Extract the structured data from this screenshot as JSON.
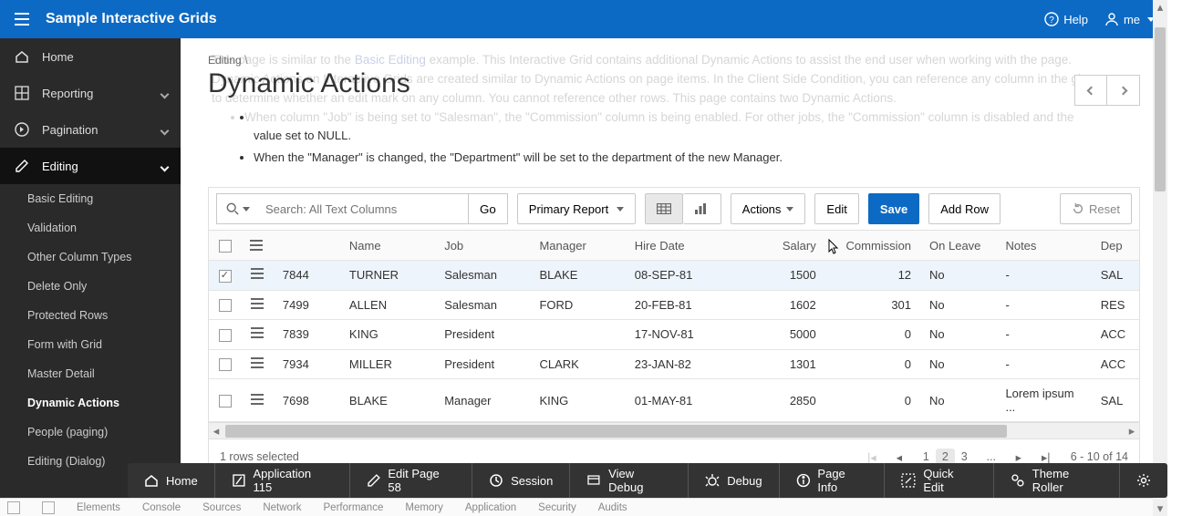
{
  "top": {
    "app_title": "Sample Interactive Grids",
    "help": "Help",
    "user": "me"
  },
  "sidebar": {
    "items": [
      {
        "icon": "home",
        "label": "Home",
        "kind": "top"
      },
      {
        "icon": "grid",
        "label": "Reporting",
        "kind": "top",
        "expandable": true
      },
      {
        "icon": "circle-right",
        "label": "Pagination",
        "kind": "top",
        "expandable": true
      },
      {
        "icon": "edit",
        "label": "Editing",
        "kind": "top",
        "expandable": true,
        "open": true
      }
    ],
    "sub": [
      "Basic Editing",
      "Validation",
      "Other Column Types",
      "Delete Only",
      "Protected Rows",
      "Form with Grid",
      "Master Detail",
      "Dynamic Actions",
      "People (paging)",
      "Editing (Dialog)"
    ],
    "active_sub": "Dynamic Actions"
  },
  "breadcrumb": {
    "parent": "Editing",
    "title": "Dynamic Actions"
  },
  "ghost": {
    "p1a": "This page is similar to the ",
    "link": "Basic Editing",
    "p1b": " example. This Interactive Grid contains additional Dynamic Actions to assist the end user when working with the page.",
    "p2": "Dynamic Actions on Interactive Grids are created similar to Dynamic Actions on page items. In the Client Side Condition, you can reference any column in the given row to determine whether an edit mark on any column. You cannot reference other rows. This page contains two Dynamic Actions.",
    "li1": "When column \"Job\" is being set to \"Salesman\", the \"Commission\" column is being enabled. For other jobs, the \"Commission\" column is disabled and the "
  },
  "desc": {
    "li1_tail": "value set to NULL.",
    "li2": "When the \"Manager\" is changed, the \"Department\" will be set to the department of the new Manager."
  },
  "toolbar": {
    "search_placeholder": "Search: All Text Columns",
    "go": "Go",
    "report_sel": "Primary Report",
    "actions": "Actions",
    "edit": "Edit",
    "save": "Save",
    "add_row": "Add Row",
    "reset": "Reset"
  },
  "grid": {
    "headers": [
      "",
      "",
      "",
      "Name",
      "Job",
      "Manager",
      "Hire Date",
      "Salary",
      "Commission",
      "On Leave",
      "Notes",
      "Dep"
    ],
    "rows": [
      {
        "selected": true,
        "id": "7844",
        "name": "TURNER",
        "job": "Salesman",
        "manager": "BLAKE",
        "hire": "08-SEP-81",
        "salary": "1500",
        "commission": "12",
        "onleave": "No",
        "notes": "-",
        "dep": "SAL"
      },
      {
        "selected": false,
        "id": "7499",
        "name": "ALLEN",
        "job": "Salesman",
        "manager": "FORD",
        "hire": "20-FEB-81",
        "salary": "1602",
        "commission": "301",
        "onleave": "No",
        "notes": "-",
        "dep": "RES"
      },
      {
        "selected": false,
        "id": "7839",
        "name": "KING",
        "job": "President",
        "manager": "",
        "hire": "17-NOV-81",
        "salary": "5000",
        "commission": "0",
        "onleave": "No",
        "notes": "-",
        "dep": "ACC"
      },
      {
        "selected": false,
        "id": "7934",
        "name": "MILLER",
        "job": "President",
        "manager": "CLARK",
        "hire": "23-JAN-82",
        "salary": "1301",
        "commission": "0",
        "onleave": "No",
        "notes": "-",
        "dep": "ACC"
      },
      {
        "selected": false,
        "id": "7698",
        "name": "BLAKE",
        "job": "Manager",
        "manager": "KING",
        "hire": "01-MAY-81",
        "salary": "2850",
        "commission": "0",
        "onleave": "No",
        "notes": "Lorem ipsum ...",
        "dep": "SAL"
      }
    ]
  },
  "footer": {
    "selection": "1 rows selected",
    "pages": [
      "1",
      "2",
      "3"
    ],
    "current_page": "2",
    "range": "6 - 10 of 14"
  },
  "devbar": [
    "Home",
    "Application 115",
    "Edit Page 58",
    "Session",
    "View Debug",
    "Debug",
    "Page Info",
    "Quick Edit",
    "Theme Roller"
  ],
  "browser_strip": [
    "Elements",
    "Console",
    "Sources",
    "Network",
    "Performance",
    "Memory",
    "Application",
    "Security",
    "Audits"
  ]
}
